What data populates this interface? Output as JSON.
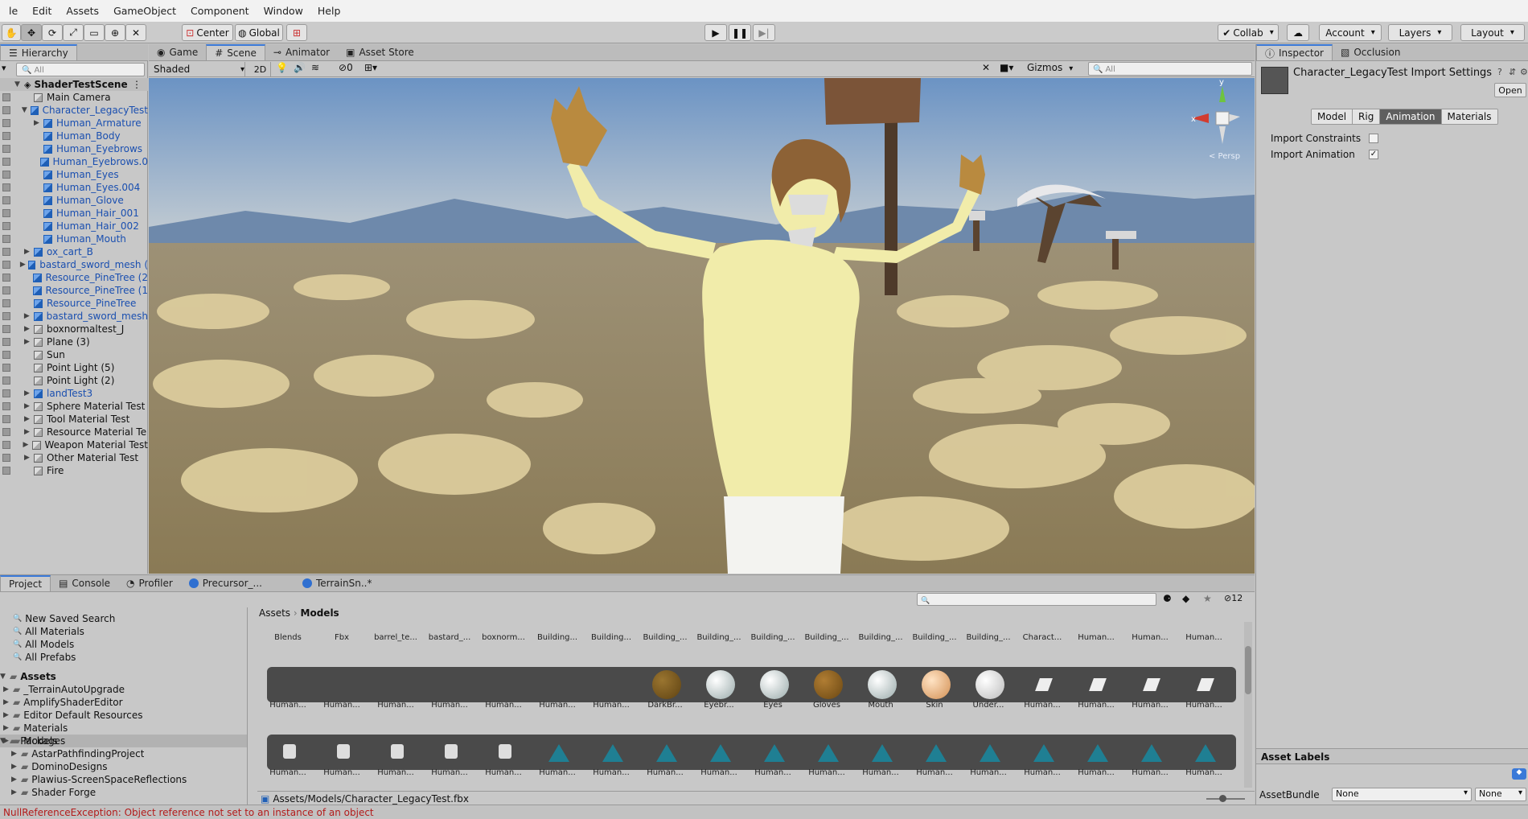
{
  "menu": [
    "le",
    "Edit",
    "Assets",
    "GameObject",
    "Component",
    "Window",
    "Help"
  ],
  "toolbar": {
    "pivot": "Center",
    "space": "Global",
    "collab": "Collab",
    "account": "Account",
    "layers": "Layers",
    "layout": "Layout"
  },
  "hierarchy": {
    "tab": "Hierarchy",
    "search_placeholder": "All",
    "scene": "ShaderTestScene",
    "items": [
      {
        "label": "Main Camera",
        "depth": 1,
        "blue": false,
        "arrow": ""
      },
      {
        "label": "Character_LegacyTest",
        "depth": 1,
        "blue": true,
        "arrow": "down"
      },
      {
        "label": "Human_Armature",
        "depth": 2,
        "blue": true,
        "arrow": "right"
      },
      {
        "label": "Human_Body",
        "depth": 2,
        "blue": true,
        "arrow": ""
      },
      {
        "label": "Human_Eyebrows",
        "depth": 2,
        "blue": true,
        "arrow": ""
      },
      {
        "label": "Human_Eyebrows.0",
        "depth": 2,
        "blue": true,
        "arrow": ""
      },
      {
        "label": "Human_Eyes",
        "depth": 2,
        "blue": true,
        "arrow": ""
      },
      {
        "label": "Human_Eyes.004",
        "depth": 2,
        "blue": true,
        "arrow": ""
      },
      {
        "label": "Human_Glove",
        "depth": 2,
        "blue": true,
        "arrow": ""
      },
      {
        "label": "Human_Hair_001",
        "depth": 2,
        "blue": true,
        "arrow": ""
      },
      {
        "label": "Human_Hair_002",
        "depth": 2,
        "blue": true,
        "arrow": ""
      },
      {
        "label": "Human_Mouth",
        "depth": 2,
        "blue": true,
        "arrow": ""
      },
      {
        "label": "ox_cart_B",
        "depth": 1,
        "blue": true,
        "arrow": "right"
      },
      {
        "label": "bastard_sword_mesh (",
        "depth": 1,
        "blue": true,
        "arrow": "right"
      },
      {
        "label": "Resource_PineTree (2",
        "depth": 1,
        "blue": true,
        "arrow": ""
      },
      {
        "label": "Resource_PineTree (1",
        "depth": 1,
        "blue": true,
        "arrow": ""
      },
      {
        "label": "Resource_PineTree",
        "depth": 1,
        "blue": true,
        "arrow": ""
      },
      {
        "label": "bastard_sword_mesh",
        "depth": 1,
        "blue": true,
        "arrow": "right"
      },
      {
        "label": "boxnormaltest_J",
        "depth": 1,
        "blue": false,
        "arrow": "right"
      },
      {
        "label": "Plane (3)",
        "depth": 1,
        "blue": false,
        "arrow": "right"
      },
      {
        "label": "Sun",
        "depth": 1,
        "blue": false,
        "arrow": ""
      },
      {
        "label": "Point Light (5)",
        "depth": 1,
        "blue": false,
        "arrow": ""
      },
      {
        "label": "Point Light (2)",
        "depth": 1,
        "blue": false,
        "arrow": ""
      },
      {
        "label": "landTest3",
        "depth": 1,
        "blue": true,
        "arrow": "right"
      },
      {
        "label": "Sphere Material Test",
        "depth": 1,
        "blue": false,
        "arrow": "right"
      },
      {
        "label": "Tool Material Test",
        "depth": 1,
        "blue": false,
        "arrow": "right"
      },
      {
        "label": "Resource Material Te",
        "depth": 1,
        "blue": false,
        "arrow": "right"
      },
      {
        "label": "Weapon Material Test",
        "depth": 1,
        "blue": false,
        "arrow": "right"
      },
      {
        "label": "Other Material Test",
        "depth": 1,
        "blue": false,
        "arrow": "right"
      },
      {
        "label": "Fire",
        "depth": 1,
        "blue": false,
        "arrow": ""
      }
    ]
  },
  "scene_tabs": [
    "Game",
    "Scene",
    "Animator",
    "Asset Store"
  ],
  "scene_toolbar": {
    "shading": "Shaded",
    "mode2d": "2D",
    "hidden_count": "0",
    "gizmos": "Gizmos",
    "search_placeholder": "All",
    "persp": "< Persp"
  },
  "inspector": {
    "tabs": [
      "Inspector",
      "Occlusion"
    ],
    "title": "Character_LegacyTest Import Settings",
    "open": "Open",
    "subtabs": [
      "Model",
      "Rig",
      "Animation",
      "Materials"
    ],
    "active_subtab": "Animation",
    "fields": [
      {
        "label": "Import Constraints",
        "checked": false
      },
      {
        "label": "Import Animation",
        "checked": true
      }
    ],
    "asset_labels": "Asset Labels",
    "assetbundle_label": "AssetBundle",
    "assetbundle_value": "None",
    "assetbundle_variant": "None"
  },
  "bottom_tabs": [
    "Project",
    "Console",
    "Profiler",
    "Precursor_...",
    "TerrainSn..*"
  ],
  "project": {
    "favorites": [
      "New Saved Search",
      "All Materials",
      "All Models",
      "All Prefabs"
    ],
    "assets_root": "Assets",
    "folders": [
      "_TerrainAutoUpgrade",
      "AmplifyShaderEditor",
      "Editor Default Resources",
      "Materials",
      "Models"
    ],
    "packages_root": "Packages",
    "packages": [
      "AstarPathfindingProject",
      "DominoDesigns",
      "Plawius-ScreenSpaceReflections",
      "Shader Forge"
    ],
    "breadcrumb": [
      "Assets",
      "Models"
    ],
    "row1_labels": [
      "Blends",
      "Fbx",
      "barrel_te...",
      "bastard_...",
      "boxnorm...",
      "Building...",
      "Building...",
      "Building_...",
      "Building_...",
      "Building_...",
      "Building_...",
      "Building_...",
      "Building_...",
      "Building_...",
      "Charact...",
      "Human...",
      "Human...",
      "Human..."
    ],
    "row2_labels": [
      "Human...",
      "Human...",
      "Human...",
      "Human...",
      "Human...",
      "Human...",
      "Human...",
      "DarkBr...",
      "Eyebr...",
      "Eyes",
      "Gloves",
      "Mouth",
      "Skin",
      "Under...",
      "Human...",
      "Human...",
      "Human...",
      "Human..."
    ],
    "row3_labels": [
      "Human...",
      "Human...",
      "Human...",
      "Human...",
      "Human...",
      "Human...",
      "Human...",
      "Human...",
      "Human...",
      "Human...",
      "Human...",
      "Human...",
      "Human...",
      "Human...",
      "Human...",
      "Human...",
      "Human...",
      "Human..."
    ],
    "footer_path": "Assets/Models/Character_LegacyTest.fbx",
    "hidden_count": "12"
  },
  "status": "NullReferenceException: Object reference not set to an instance of an object"
}
